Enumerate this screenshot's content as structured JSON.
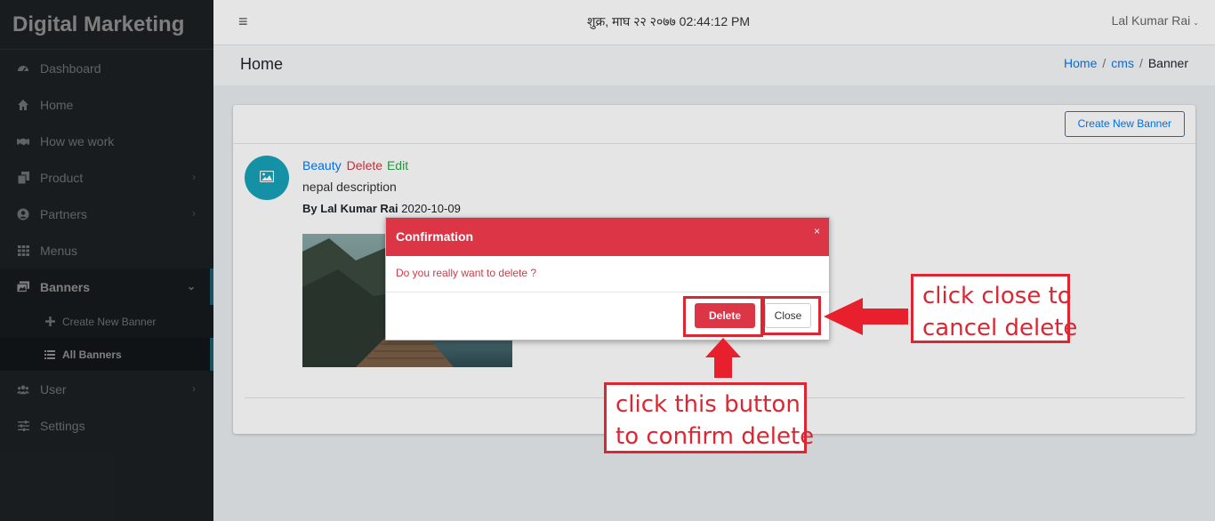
{
  "app": {
    "brand": "Digital Marketing"
  },
  "sidebar": {
    "items": [
      {
        "label": "Dashboard",
        "icon": "dashboard-icon",
        "has_children": false
      },
      {
        "label": "Home",
        "icon": "home-icon",
        "has_children": false
      },
      {
        "label": "How we work",
        "icon": "handshake-icon",
        "has_children": false
      },
      {
        "label": "Product",
        "icon": "copy-icon",
        "has_children": true
      },
      {
        "label": "Partners",
        "icon": "user-circle-icon",
        "has_children": true
      },
      {
        "label": "Menus",
        "icon": "grid-icon",
        "has_children": false
      },
      {
        "label": "Banners",
        "icon": "images-icon",
        "has_children": true,
        "expanded": true
      },
      {
        "label": "User",
        "icon": "users-icon",
        "has_children": true
      },
      {
        "label": "Settings",
        "icon": "sliders-icon",
        "has_children": false
      }
    ],
    "banners_children": [
      {
        "label": "Create New Banner",
        "icon": "plus-icon"
      },
      {
        "label": "All Banners",
        "icon": "list-icon",
        "active": true
      }
    ]
  },
  "header": {
    "menu_icon": "hamburger-icon",
    "datetime": "शुक्र, माघ २२ २०७७ 02:44:12 PM",
    "user": "Lal Kumar Rai"
  },
  "content_header": {
    "title": "Home",
    "breadcrumb": [
      "Home",
      "cms",
      "Banner"
    ]
  },
  "card": {
    "create_button": "Create New Banner",
    "post": {
      "category": "Beauty",
      "delete_label": "Delete",
      "edit_label": "Edit",
      "description": "nepal description",
      "by_prefix": "By",
      "author": "Lal Kumar Rai",
      "date": "2020-10-09"
    }
  },
  "modal": {
    "title": "Confirmation",
    "close_x": "×",
    "message": "Do you really want to delete ?",
    "delete_button": "Delete",
    "close_button": "Close"
  },
  "annotations": {
    "close_note": [
      "click close to",
      "cancel delete"
    ],
    "delete_note": [
      "click this button",
      "to confirm delete"
    ]
  },
  "colors": {
    "sidebar_bg": "#343a40",
    "accent": "#2fa6c6",
    "danger": "#dc3545",
    "primary": "#007bff",
    "success": "#28a745",
    "annotation_red": "#dc2632"
  }
}
